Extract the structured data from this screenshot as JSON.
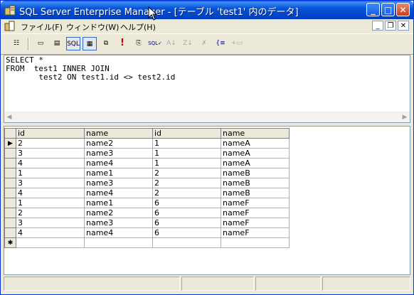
{
  "window": {
    "title": "SQL Server Enterprise Manager - [テーブル 'test1' 内のデータ]",
    "buttons": {
      "minimize": "_",
      "maximize": "□",
      "close": "✕"
    }
  },
  "menu": {
    "items": [
      "ファイル(F)",
      "ウィンドウ(W)",
      "ヘルプ(H)"
    ],
    "mdi_buttons": {
      "minimize": "_",
      "restore": "❐",
      "close": "✕"
    }
  },
  "toolbar": {
    "tools": [
      {
        "name": "properties-tool",
        "glyph": "☷"
      },
      {
        "name": "show-diagram-pane",
        "glyph": "▭"
      },
      {
        "name": "show-grid-pane",
        "glyph": "▤"
      },
      {
        "name": "show-sql-pane",
        "glyph": "SQL"
      },
      {
        "name": "show-results-pane",
        "glyph": "▦"
      },
      {
        "name": "change-query-type",
        "glyph": "⧉"
      },
      {
        "name": "run",
        "glyph": "!"
      },
      {
        "name": "cancel-execution",
        "glyph": "⎘"
      },
      {
        "name": "verify-sql",
        "glyph": "SQL✓"
      },
      {
        "name": "sort-ascending",
        "glyph": "A↓"
      },
      {
        "name": "sort-descending",
        "glyph": "Z↓"
      },
      {
        "name": "remove-filter",
        "glyph": "✗"
      },
      {
        "name": "group-by",
        "glyph": "{≡"
      },
      {
        "name": "add-table",
        "glyph": "+▭"
      }
    ]
  },
  "sql": {
    "text": "SELECT *\nFROM  test1 INNER JOIN\n       test2 ON test1.id <> test2.id"
  },
  "grid": {
    "columns": [
      "id",
      "name",
      "id",
      "name"
    ],
    "rows": [
      [
        "2",
        "name2",
        "1",
        "nameA"
      ],
      [
        "3",
        "name3",
        "1",
        "nameA"
      ],
      [
        "4",
        "name4",
        "1",
        "nameA"
      ],
      [
        "1",
        "name1",
        "2",
        "nameB"
      ],
      [
        "3",
        "name3",
        "2",
        "nameB"
      ],
      [
        "4",
        "name4",
        "2",
        "nameB"
      ],
      [
        "1",
        "name1",
        "6",
        "nameF"
      ],
      [
        "2",
        "name2",
        "6",
        "nameF"
      ],
      [
        "3",
        "name3",
        "6",
        "nameF"
      ],
      [
        "4",
        "name4",
        "6",
        "nameF"
      ]
    ],
    "current_row_marker": "▶",
    "new_row_marker": "✱"
  },
  "colors": {
    "titlebar": "#0755d6",
    "face": "#ece9d8",
    "border": "#7f9db9"
  }
}
